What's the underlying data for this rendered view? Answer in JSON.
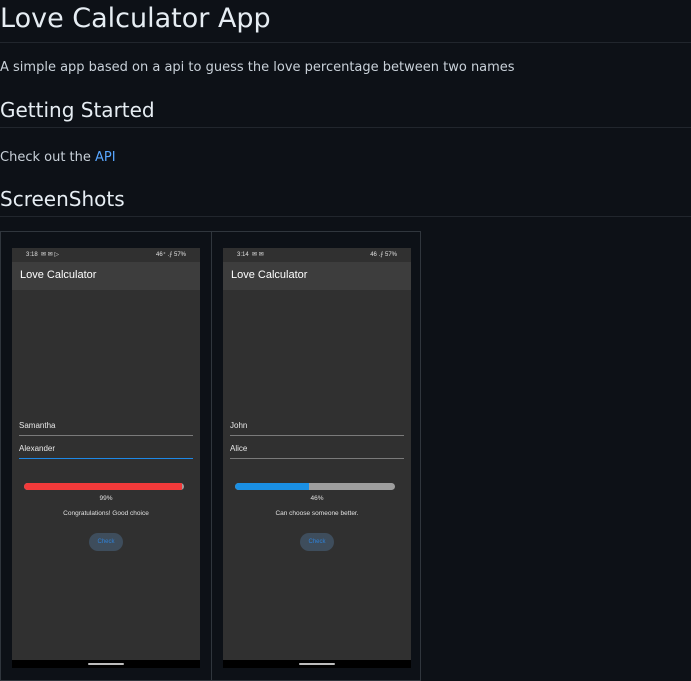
{
  "readme": {
    "title": "Love Calculator App",
    "description": "A simple app based on a api to guess the love percentage between two names",
    "getting_started_heading": "Getting Started",
    "check_out_prefix": "Check out the",
    "api_link": "API",
    "screenshots_heading": "ScreenShots"
  },
  "screenshots": [
    {
      "status_time": "3:18",
      "status_left_icons": "✉ ✉ ▷",
      "status_right": "46⁺ .⨍ 57%",
      "app_title": "Love Calculator",
      "name1": "Samantha",
      "name2": "Alexander",
      "percentage_value": 0.99,
      "percentage_text": "99%",
      "message": "Congratulations! Good choice",
      "button_label": "Check",
      "bar_color": "#f23a3a"
    },
    {
      "status_time": "3:14",
      "status_left_icons": "✉ ✉",
      "status_right": "46 .⨍ 57%",
      "app_title": "Love Calculator",
      "name1": "John",
      "name2": "Alice",
      "percentage_value": 0.46,
      "percentage_text": "46%",
      "message": "Can choose someone better.",
      "button_label": "Check",
      "bar_color": "#1a8fe3"
    }
  ],
  "colors": {
    "page_bg": "#0d1117",
    "link": "#58a6ff",
    "phone_bg": "#303030",
    "appbar_bg": "#3d3d3d"
  }
}
